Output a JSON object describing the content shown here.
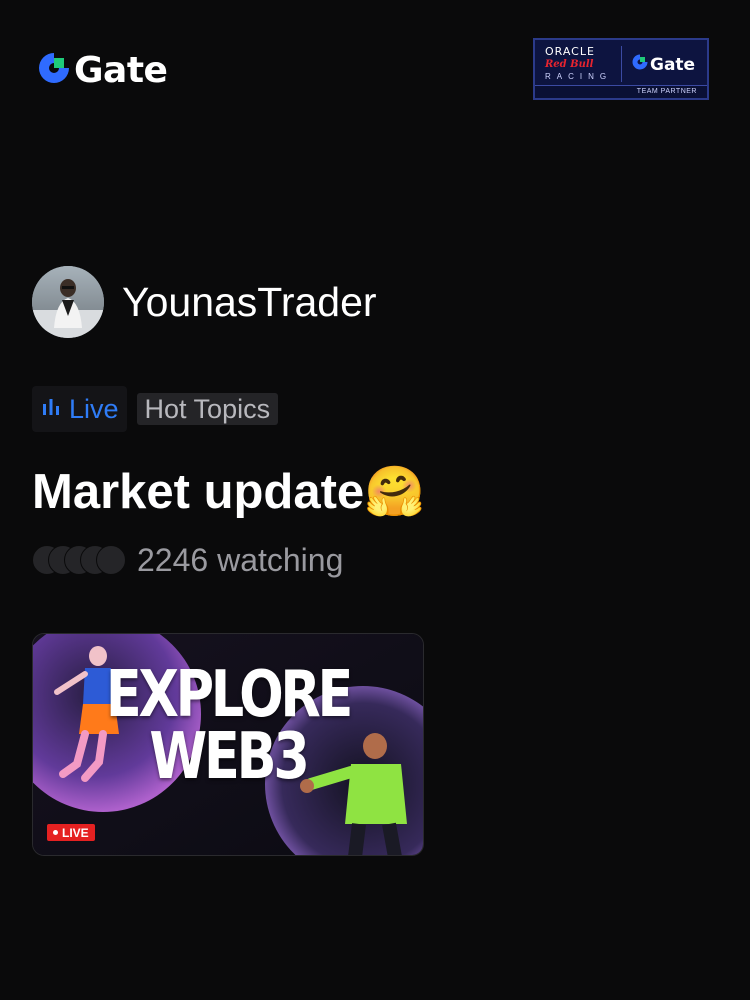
{
  "header": {
    "logo_text": "Gate",
    "logo_icon": "gate-logo-icon",
    "partner": {
      "oracle": "ORACLE",
      "redbull": "Red Bull",
      "racing": "RACING",
      "gate": "Gate",
      "footer": "TEAM PARTNER"
    }
  },
  "profile": {
    "username": "YounasTrader"
  },
  "tags": {
    "live_label": "Live",
    "live_icon": "bar-chart-icon",
    "topic_label": "Hot Topics"
  },
  "stream": {
    "title": "Market update🤗",
    "watching": "2246 watching"
  },
  "thumbnail": {
    "title": "EXPLORE\nWEB3",
    "live_badge": "LIVE"
  },
  "colors": {
    "background": "#0a0a0b",
    "accent_blue": "#2f7cf6",
    "logo_green": "#1fcb7a",
    "live_red": "#e52121"
  }
}
